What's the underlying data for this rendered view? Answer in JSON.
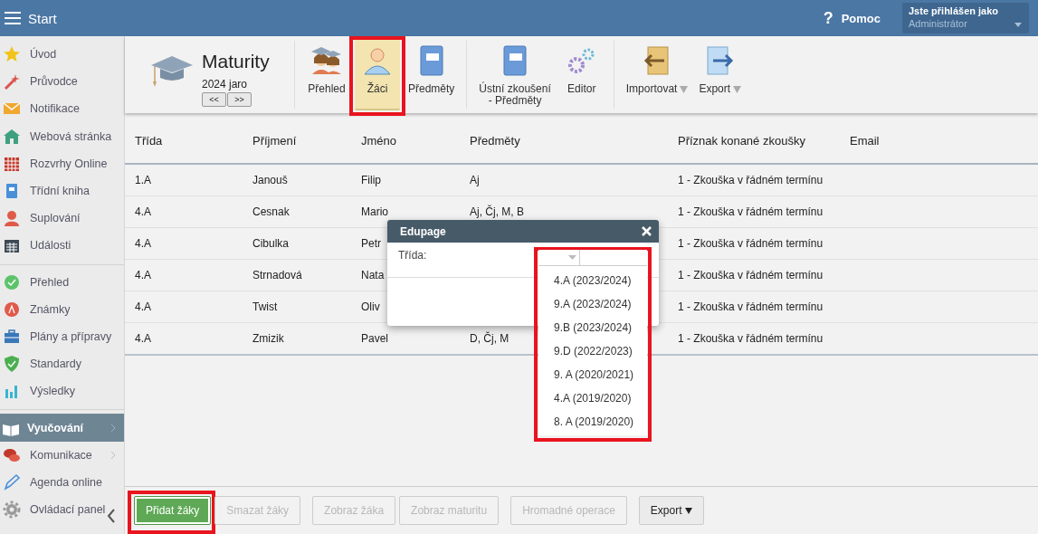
{
  "header": {
    "title": "Start",
    "help_icon": "?",
    "help_label": "Pomoc",
    "user": {
      "caption": "Jste přihlášen jako",
      "name": "Administrátor"
    }
  },
  "sidebar": {
    "groups": [
      {
        "items": [
          {
            "label": "Úvod",
            "selected": false,
            "submenu": false
          },
          {
            "label": "Průvodce",
            "selected": false,
            "submenu": false
          },
          {
            "label": "Notifikace",
            "selected": false,
            "submenu": false
          },
          {
            "label": "Webová stránka",
            "selected": false,
            "submenu": false
          },
          {
            "label": "Rozvrhy Online",
            "selected": false,
            "submenu": false
          },
          {
            "label": "Třídní kniha",
            "selected": false,
            "submenu": false
          },
          {
            "label": "Suplování",
            "selected": false,
            "submenu": false
          },
          {
            "label": "Události",
            "selected": false,
            "submenu": false
          }
        ]
      },
      {
        "items": [
          {
            "label": "Přehled",
            "selected": false,
            "submenu": false
          },
          {
            "label": "Známky",
            "selected": false,
            "submenu": false
          },
          {
            "label": "Plány a přípravy",
            "selected": false,
            "submenu": false
          },
          {
            "label": "Standardy",
            "selected": false,
            "submenu": false
          },
          {
            "label": "Výsledky",
            "selected": false,
            "submenu": false
          }
        ]
      },
      {
        "items": [
          {
            "label": "Vyučování",
            "selected": true,
            "submenu": true
          },
          {
            "label": "Komunikace",
            "selected": false,
            "submenu": true
          },
          {
            "label": "Agenda online",
            "selected": false,
            "submenu": false
          },
          {
            "label": "Ovládací panel",
            "selected": false,
            "submenu": false
          }
        ]
      }
    ]
  },
  "module": {
    "title": "Maturity",
    "period": "2024 jaro",
    "prev": "<<",
    "next": ">>"
  },
  "toolbar": {
    "groups": [
      {
        "items": [
          {
            "label": "Přehled",
            "selected": false,
            "highlighted": false,
            "dropdown": false
          },
          {
            "label": "Žáci",
            "selected": true,
            "highlighted": true,
            "dropdown": false
          },
          {
            "label": "Předměty",
            "selected": false,
            "highlighted": false,
            "dropdown": false
          }
        ]
      },
      {
        "items": [
          {
            "label": "Ústní zkoušení\n- Předměty",
            "selected": false,
            "highlighted": false,
            "dropdown": false
          },
          {
            "label": "Editor",
            "selected": false,
            "highlighted": false,
            "dropdown": false
          }
        ]
      },
      {
        "items": [
          {
            "label": "Importovat",
            "selected": false,
            "highlighted": false,
            "dropdown": true
          },
          {
            "label": "Export",
            "selected": false,
            "highlighted": false,
            "dropdown": true
          }
        ]
      }
    ]
  },
  "table": {
    "columns": [
      "Třída",
      "Příjmení",
      "Jméno",
      "Předměty",
      "Příznak konané zkoušky",
      "Email"
    ],
    "rows": [
      [
        "1.A",
        "Janouš",
        "Filip",
        "Aj",
        "1 - Zkouška v řádném termínu",
        ""
      ],
      [
        "4.A",
        "Cesnak",
        "Mario",
        "Aj, Čj, M, B",
        "1 - Zkouška v řádném termínu",
        ""
      ],
      [
        "4.A",
        "Cibulka",
        "Petr",
        "",
        "1 - Zkouška v řádném termínu",
        ""
      ],
      [
        "4.A",
        "Strnadová",
        "Nata",
        "",
        "1 - Zkouška v řádném termínu",
        ""
      ],
      [
        "4.A",
        "Twist",
        "Oliv",
        "",
        "1 - Zkouška v řádném termínu",
        ""
      ],
      [
        "4.A",
        "Zmizik",
        "Pavel",
        "D, Čj, M",
        "1 - Zkouška v řádném termínu",
        ""
      ]
    ]
  },
  "dialog": {
    "title": "Edupage",
    "field_label": "Třída:",
    "dropdown": {
      "highlighted": true,
      "options": [
        "4.A (2023/2024)",
        "9.A (2023/2024)",
        "9.B (2023/2024)",
        "9.D (2022/2023)",
        "9. A (2020/2021)",
        "4.A (2019/2020)",
        "8. A (2019/2020)"
      ]
    }
  },
  "footer": {
    "groups": [
      [
        {
          "label": "Přidat žáky",
          "kind": "primary",
          "disabled": false,
          "highlighted": true,
          "dropdown": false
        },
        {
          "label": "Smazat žáky",
          "kind": "normal",
          "disabled": true,
          "highlighted": false,
          "dropdown": false
        }
      ],
      [
        {
          "label": "Zobraz žáka",
          "kind": "normal",
          "disabled": true,
          "highlighted": false,
          "dropdown": false
        },
        {
          "label": "Zobraz maturitu",
          "kind": "normal",
          "disabled": true,
          "highlighted": false,
          "dropdown": false
        }
      ],
      [
        {
          "label": "Hromadné operace",
          "kind": "normal",
          "disabled": true,
          "highlighted": false,
          "dropdown": false
        }
      ],
      [
        {
          "label": "Export",
          "kind": "normal",
          "disabled": false,
          "highlighted": false,
          "dropdown": true
        }
      ]
    ]
  }
}
